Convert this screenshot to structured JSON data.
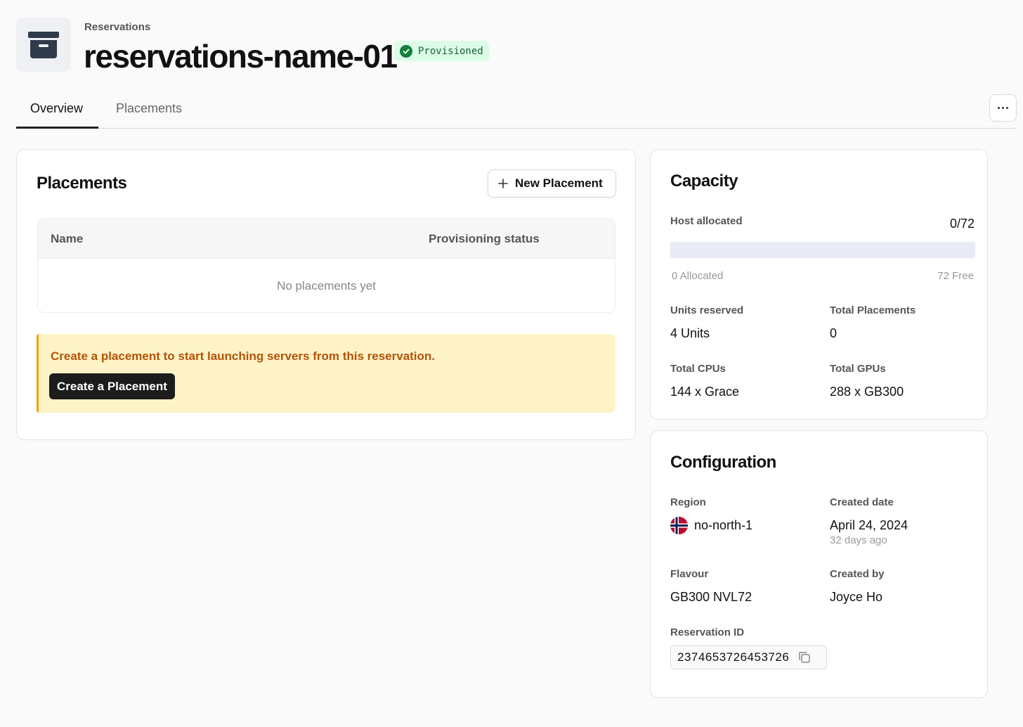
{
  "header": {
    "breadcrumb": "Reservations",
    "title": "reservations-name-01",
    "status": "Provisioned",
    "icon": "archive-box-icon"
  },
  "tabs": [
    {
      "label": "Overview",
      "active": true
    },
    {
      "label": "Placements",
      "active": false
    }
  ],
  "placements_card": {
    "title": "Placements",
    "new_button_label": "New Placement",
    "columns": [
      "Name",
      "Provisioning status"
    ],
    "empty_text": "No placements yet",
    "callout_text": "Create a placement to start launching servers from this reservation.",
    "callout_button": "Create a Placement"
  },
  "capacity": {
    "title": "Capacity",
    "host_allocated_label": "Host allocated",
    "host_allocated_value": "0/72",
    "allocated_fraction": 0,
    "allocated_text": "0 Allocated",
    "free_text": "72 Free",
    "units_reserved_label": "Units reserved",
    "units_reserved_value": "4 Units",
    "total_placements_label": "Total Placements",
    "total_placements_value": "0",
    "total_cpus_label": "Total CPUs",
    "total_cpus_value": "144 x Grace",
    "total_gpus_label": "Total GPUs",
    "total_gpus_value": "288 x GB300"
  },
  "configuration": {
    "title": "Configuration",
    "region_label": "Region",
    "region_value": "no-north-1",
    "region_flag": "norway-flag-icon",
    "created_date_label": "Created date",
    "created_date_value": "April 24, 2024",
    "created_relative": "32 days ago",
    "flavour_label": "Flavour",
    "flavour_value": "GB300 NVL72",
    "created_by_label": "Created by",
    "created_by_value": "Joyce Ho",
    "reservation_id_label": "Reservation ID",
    "reservation_id_value": "2374653726453726"
  },
  "colors": {
    "status_bg": "#dcfce7",
    "status_text": "#166534",
    "callout_bg": "#fef3c7",
    "callout_border": "#f59e0b",
    "callout_text": "#b45309",
    "progress_track": "#e8eaf6"
  }
}
